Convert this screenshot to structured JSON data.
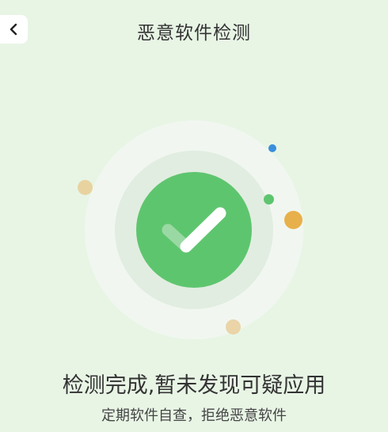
{
  "header": {
    "title": "恶意软件检测",
    "back_icon": "chevron-left-icon"
  },
  "result": {
    "status_icon": "check-icon",
    "title": "检测完成,暂未发现可疑应用",
    "subtitle": "定期软件自查，拒绝恶意软件"
  },
  "colors": {
    "background": "#e8f5e5",
    "accent_green": "#5ec56f",
    "dot_blue": "#3a8fdc",
    "dot_orange": "#e8b04a",
    "dot_tan": "#e8d3a0"
  }
}
